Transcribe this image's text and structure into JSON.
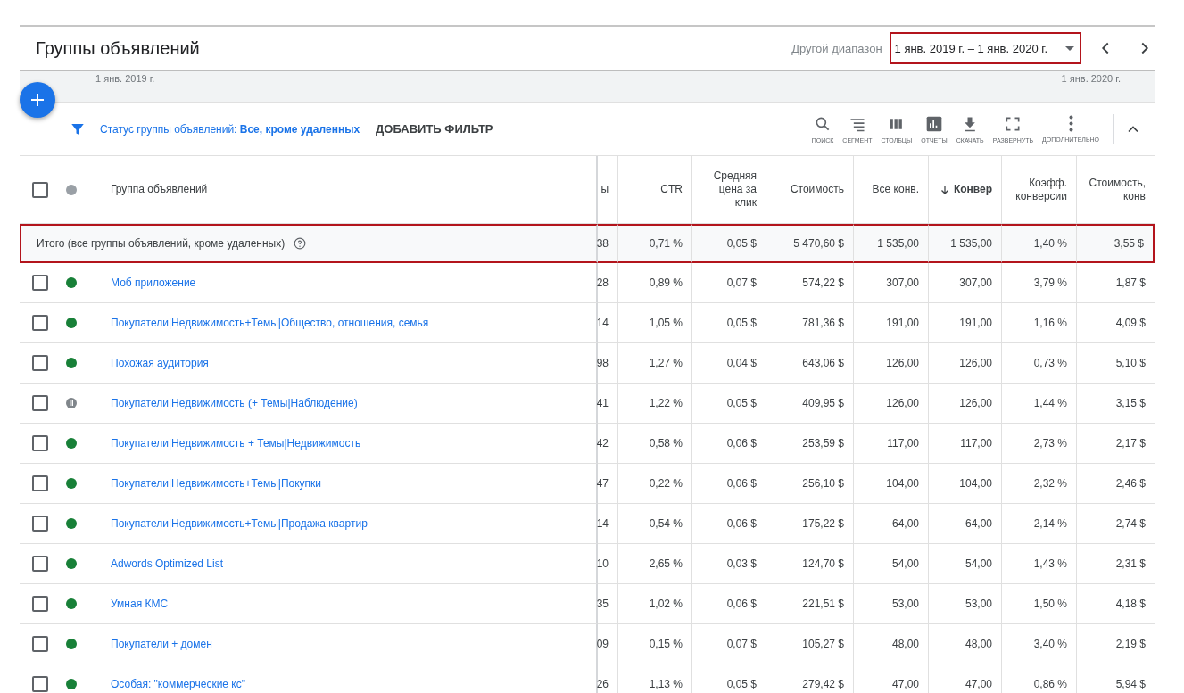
{
  "page_title": "Группы объявлений",
  "date_range": {
    "label": "Другой диапазон",
    "value": "1 янв. 2019 г. – 1 янв. 2020 г.",
    "highlighted": true
  },
  "timeline": {
    "start": "1 янв. 2019 г.",
    "end": "1 янв. 2020 г."
  },
  "filter": {
    "label": "Статус группы объявлений: **Все, кроме удаленных**",
    "add_button": "ДОБАВИТЬ ФИЛЬТР"
  },
  "toolbar": [
    {
      "kind": "search",
      "label": "ПОИСК"
    },
    {
      "kind": "segment",
      "label": "СЕГМЕНТ"
    },
    {
      "kind": "columns",
      "label": "СТОЛБЦЫ"
    },
    {
      "kind": "reports",
      "label": "ОТЧЕТЫ"
    },
    {
      "kind": "download",
      "label": "СКАЧАТЬ"
    },
    {
      "kind": "expand",
      "label": "РАЗВЕРНУТЬ"
    },
    {
      "kind": "more",
      "label": "ДОПОЛНИТЕЛЬНО"
    }
  ],
  "table": {
    "name_column": "Группа объявлений",
    "select_all": {
      "checked": false
    },
    "columns": [
      {
        "label": "ы",
        "sorted": false
      },
      {
        "label": "CTR",
        "sorted": false
      },
      {
        "label": "Средняя цена за клик",
        "sorted": false
      },
      {
        "label": "Стоимость",
        "sorted": false
      },
      {
        "label": "Все конв.",
        "sorted": false
      },
      {
        "label": "Конвер",
        "sorted": true
      },
      {
        "label": "Коэфф. конверсии",
        "sorted": false
      },
      {
        "label": "Стоимость, конв",
        "sorted": false
      }
    ],
    "total": {
      "label": "Итого (все группы объявлений, кроме удаленных)",
      "highlighted": true,
      "values": [
        "38",
        "0,71 %",
        "0,05 $",
        "5 470,60 $",
        "1 535,00",
        "1 535,00",
        "1,40 %",
        "3,55 $"
      ]
    },
    "rows": [
      {
        "name": "Моб приложение",
        "kind": "active",
        "checked": false,
        "values": [
          "28",
          "0,89 %",
          "0,07 $",
          "574,22 $",
          "307,00",
          "307,00",
          "3,79 %",
          "1,87 $"
        ]
      },
      {
        "name": "Покупатели|Недвижимость+Темы|Общество, отношения, семья",
        "kind": "active",
        "checked": false,
        "values": [
          "14",
          "1,05 %",
          "0,05 $",
          "781,36 $",
          "191,00",
          "191,00",
          "1,16 %",
          "4,09 $"
        ]
      },
      {
        "name": "Похожая аудитория",
        "kind": "active",
        "checked": false,
        "values": [
          "98",
          "1,27 %",
          "0,04 $",
          "643,06 $",
          "126,00",
          "126,00",
          "0,73 %",
          "5,10 $"
        ]
      },
      {
        "name": "Покупатели|Недвижимость (+ Темы|Наблюдение)",
        "kind": "paused",
        "checked": false,
        "values": [
          "41",
          "1,22 %",
          "0,05 $",
          "409,95 $",
          "126,00",
          "126,00",
          "1,44 %",
          "3,15 $"
        ]
      },
      {
        "name": "Покупатели|Недвижимость + Темы|Недвижимость",
        "kind": "active",
        "checked": false,
        "values": [
          "42",
          "0,58 %",
          "0,06 $",
          "253,59 $",
          "117,00",
          "117,00",
          "2,73 %",
          "2,17 $"
        ]
      },
      {
        "name": "Покупатели|Недвижимость+Темы|Покупки",
        "kind": "active",
        "checked": false,
        "values": [
          "47",
          "0,22 %",
          "0,06 $",
          "256,10 $",
          "104,00",
          "104,00",
          "2,32 %",
          "2,46 $"
        ]
      },
      {
        "name": "Покупатели|Недвижимость+Темы|Продажа квартир",
        "kind": "active",
        "checked": false,
        "values": [
          "14",
          "0,54 %",
          "0,06 $",
          "175,22 $",
          "64,00",
          "64,00",
          "2,14 %",
          "2,74 $"
        ]
      },
      {
        "name": "Adwords Optimized List",
        "kind": "active",
        "checked": false,
        "values": [
          "10",
          "2,65 %",
          "0,03 $",
          "124,70 $",
          "54,00",
          "54,00",
          "1,43 %",
          "2,31 $"
        ]
      },
      {
        "name": "Умная КМС",
        "kind": "active",
        "checked": false,
        "values": [
          "35",
          "1,02 %",
          "0,06 $",
          "221,51 $",
          "53,00",
          "53,00",
          "1,50 %",
          "4,18 $"
        ]
      },
      {
        "name": "Покупатели + домен",
        "kind": "active",
        "checked": false,
        "values": [
          "09",
          "0,15 %",
          "0,07 $",
          "105,27 $",
          "48,00",
          "48,00",
          "3,40 %",
          "2,19 $"
        ]
      },
      {
        "name": "Особая: \"коммерческие кс\"",
        "kind": "active",
        "checked": false,
        "values": [
          "26",
          "1,13 %",
          "0,05 $",
          "279,42 $",
          "47,00",
          "47,00",
          "0,86 %",
          "5,94 $"
        ]
      }
    ]
  }
}
